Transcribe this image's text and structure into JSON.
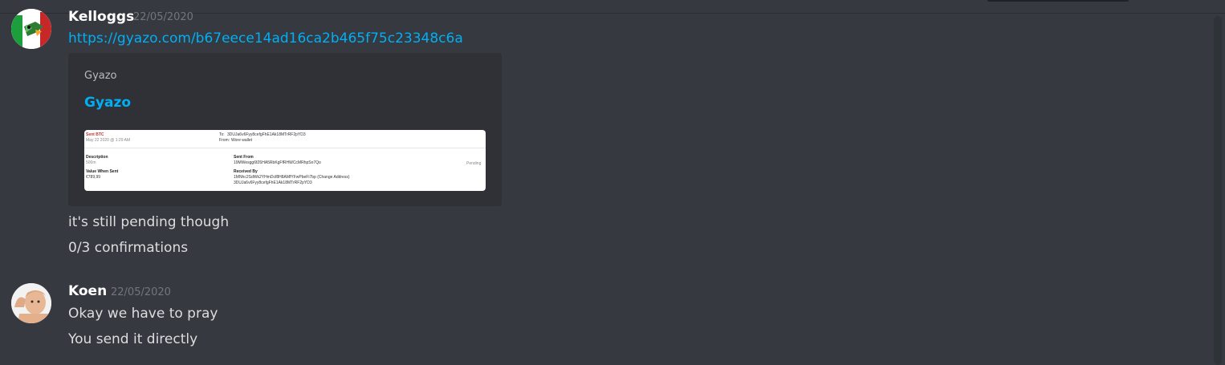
{
  "messages": [
    {
      "author": "Kelloggs",
      "timestamp": "22/05/2020",
      "link": "https://gyazo.com/b67eece14ad16ca2b465f75c23348c6a",
      "embed": {
        "provider": "Gyazo",
        "title": "Gyazo",
        "image": {
          "sent_label": "Sent BTC",
          "date": "May 22 2020 @ 1:29 AM",
          "to_label": "To:",
          "to_value": "3DUJa6v6Fyy8cefgFhE1Ak18MTrRF2pYD3",
          "from_label": "From:",
          "from_value": "Wore wallet",
          "description_label": "Description",
          "description_value": "500m",
          "value_label": "Value When Sent",
          "value_value": "€789,99",
          "sent_from_label": "Sent From",
          "sent_from_value": "19MWesgg6fZ6HA5RbKgFfRHWCcMRhpSn7Qo",
          "received_by_label": "Received By",
          "received_by_value_1": "1MNhc2SdWk2YHmDcf8H8AMfYFwPbeFi7bp (Change Address)",
          "received_by_value_2": "3DUJa6v6Fyy8cefgFhE1Ak18MTrRF2pYD3",
          "status": "Pending"
        }
      },
      "lines": [
        "it's still pending though",
        "0/3 confirmations"
      ]
    },
    {
      "author": "Koen",
      "timestamp": "22/05/2020",
      "lines": [
        "Okay we have to pray",
        "You send it directly"
      ]
    }
  ]
}
